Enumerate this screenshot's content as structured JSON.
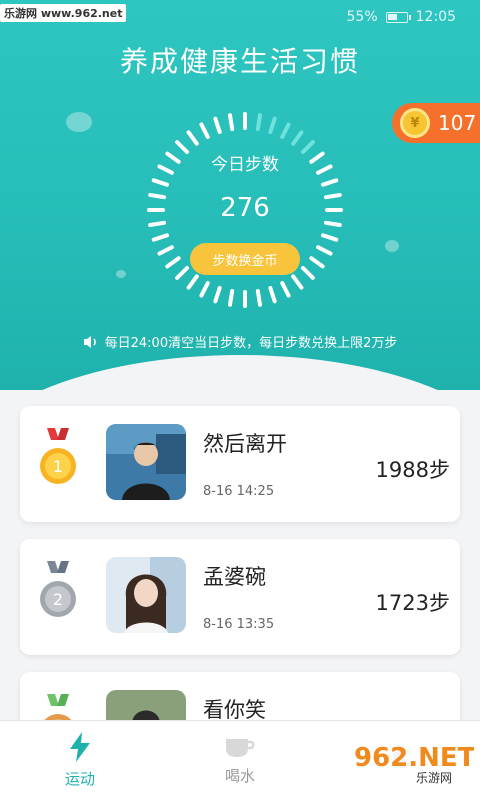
{
  "statusbar": {
    "watermark": "乐游网 www.962.net",
    "battery": "55%",
    "time": "12:05"
  },
  "header": {
    "title": "养成健康生活习惯"
  },
  "coins": {
    "icon": "yen-coin-icon",
    "amount": "107",
    "coin_glyph": "¥"
  },
  "dial": {
    "label": "今日步数",
    "value": "276",
    "button": "步数换金币"
  },
  "notice": "每日24:00清空当日步数，每日步数兑换上限2万步",
  "ranking": [
    {
      "rank": "1",
      "name": "然后离开",
      "time": "8-16 14:25",
      "steps": "1988步"
    },
    {
      "rank": "2",
      "name": "孟婆碗",
      "time": "8-16 13:35",
      "steps": "1723步"
    },
    {
      "rank": "3",
      "name": "看你笑",
      "time": "",
      "steps": ""
    }
  ],
  "tabs": [
    {
      "label": "运动",
      "icon": "lightning-icon",
      "active": true
    },
    {
      "label": "喝水",
      "icon": "cup-icon",
      "active": false
    },
    {
      "label": "",
      "icon": "sleep-icon",
      "active": false
    }
  ],
  "logo": {
    "text": "962.NET",
    "subtext": "乐游网"
  },
  "colors": {
    "teal": "#27bdb8",
    "orange": "#f5712b",
    "gold": "#f7c43b"
  }
}
